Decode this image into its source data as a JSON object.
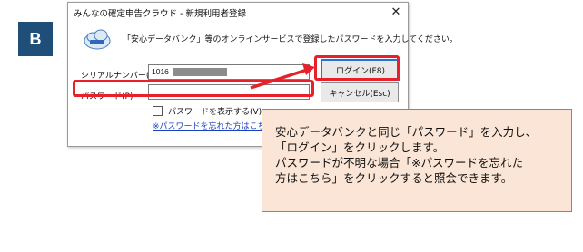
{
  "step_badge": "B",
  "dialog": {
    "title": "みんなの確定申告クラウド - 新規利用者登録",
    "close_glyph": "✕",
    "logo_icon": "cloud-app-logo",
    "description": "「安心データバンク」等のオンラインサービスで登録したパスワードを入力してください。",
    "serial_label": "シリアルナンバー(S)",
    "serial_value": "1016",
    "password_label": "パスワード(P)",
    "password_value": "",
    "show_password_label": "パスワードを表示する(V)",
    "show_password_checked": false,
    "forgot_link": "※パスワードを忘れた方はこちら",
    "login_button": "ログイン(F8)",
    "cancel_button": "キャンセル(Esc)"
  },
  "annotation_color": "#e8202a",
  "callout": {
    "lines": [
      "安心データバンクと同じ「パスワード」を入力し、",
      "「ログイン」をクリックします。",
      "パスワードが不明な場合「※パスワードを忘れた",
      "方はこちら」をクリックすると照会できます。"
    ],
    "background": "#fbe5d6"
  }
}
